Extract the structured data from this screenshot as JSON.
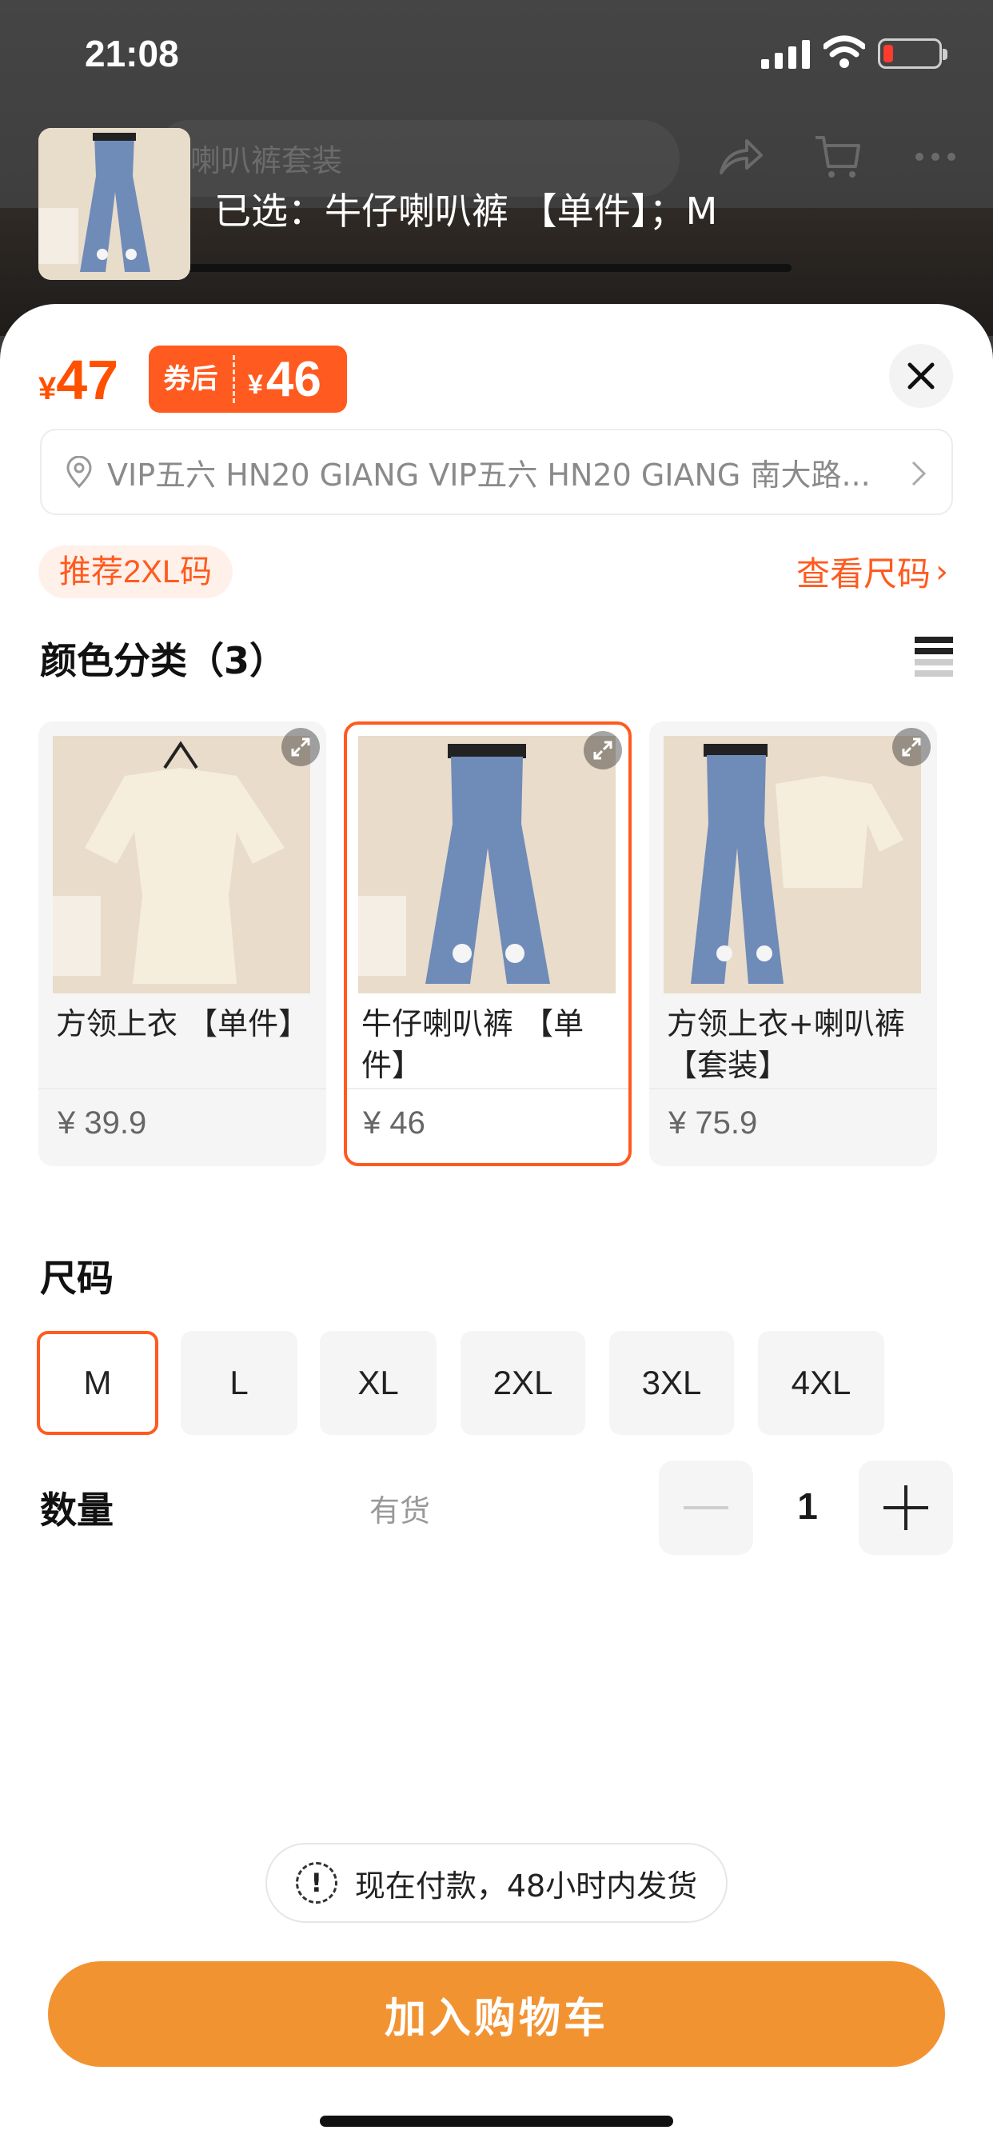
{
  "status_bar": {
    "time": "21:08"
  },
  "header": {
    "bg_title": "喇叭裤套装",
    "selected_label": "已选：牛仔喇叭裤 【单件】；M"
  },
  "price": {
    "currency": "¥",
    "current": "47",
    "coupon_label": "券后",
    "coupon_currency": "¥",
    "coupon_price": "46"
  },
  "address": {
    "text": "VIP五六 HN20 GIANG VIP五六 HN20 GIANG 南大路..."
  },
  "recommend": {
    "badge": "推荐2XL码",
    "size_guide": "查看尺码"
  },
  "color_section": {
    "title": "颜色分类（3）",
    "options": [
      {
        "name": "方领上衣 【单件】",
        "price": "¥ 39.9",
        "selected": false,
        "product": "top"
      },
      {
        "name": "牛仔喇叭裤 【单件】",
        "price": "¥ 46",
        "selected": true,
        "product": "jeans"
      },
      {
        "name": "方领上衣+喇叭裤【套装】",
        "price": "¥ 75.9",
        "selected": false,
        "product": "set"
      }
    ]
  },
  "size_section": {
    "title": "尺码",
    "sizes": [
      "M",
      "L",
      "XL",
      "2XL",
      "3XL",
      "4XL"
    ],
    "selected": "M"
  },
  "quantity": {
    "label": "数量",
    "stock": "有货",
    "value": "1"
  },
  "notice": {
    "text": "现在付款，48小时内发货"
  },
  "cta": {
    "label": "加入购物车"
  },
  "colors": {
    "accent": "#ff5a1f",
    "cta": "#f29332"
  },
  "icons": [
    "location-pin-icon",
    "chevron-right-icon",
    "close-icon",
    "share-icon",
    "cart-icon",
    "more-icon",
    "list-view-icon",
    "expand-icon",
    "minus-icon",
    "plus-icon",
    "info-icon"
  ]
}
